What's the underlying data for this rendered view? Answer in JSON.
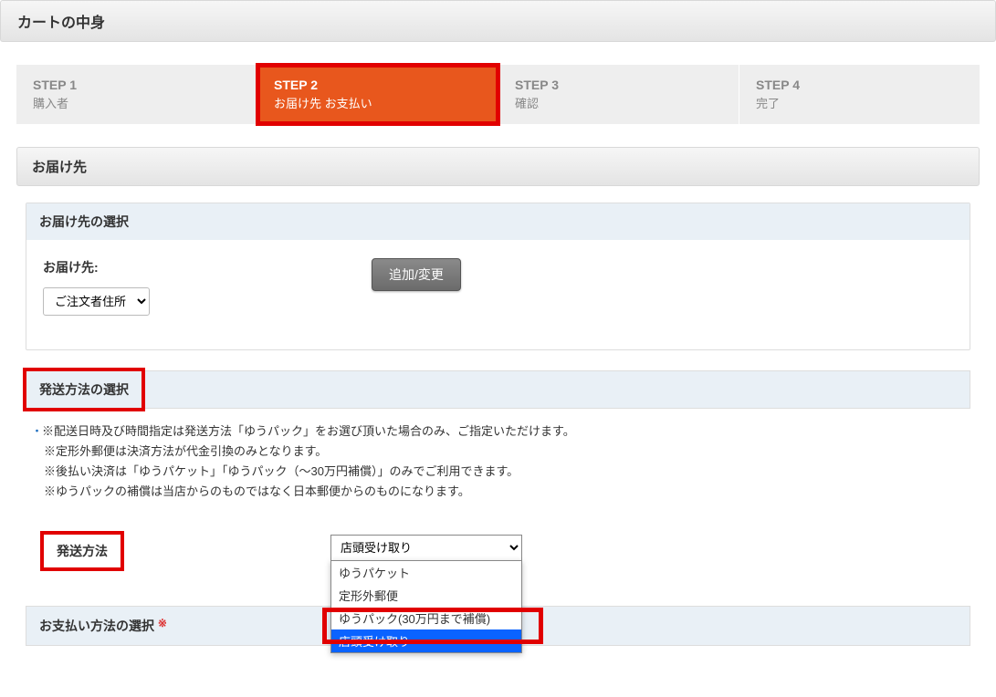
{
  "page_title": "カートの中身",
  "steps": [
    {
      "num": "STEP 1",
      "label": "購入者"
    },
    {
      "num": "STEP 2",
      "label": "お届け先 お支払い"
    },
    {
      "num": "STEP 3",
      "label": "確認"
    },
    {
      "num": "STEP 4",
      "label": "完了"
    }
  ],
  "active_step_index": 1,
  "delivery": {
    "section_title": "お届け先",
    "panel_title": "お届け先の選択",
    "label": "お届け先:",
    "select_value": "ご注文者住所",
    "add_change_button": "追加/変更"
  },
  "shipping": {
    "panel_title": "発送方法の選択",
    "notes": [
      "※配送日時及び時間指定は発送方法「ゆうパック」をお選び頂いた場合のみ、ご指定いただけます。",
      "※定形外郵便は決済方法が代金引換のみとなります。",
      "※後払い決済は「ゆうパケット」「ゆうパック（～30万円補償）」のみでご利用できます。",
      "※ゆうパックの補償は当店からのものではなく日本郵便からのものになります。"
    ],
    "label": "発送方法",
    "selected": "店頭受け取り",
    "options": [
      "ゆうパケット",
      "定形外郵便",
      "ゆうパック(30万円まで補償)",
      "店頭受け取り"
    ]
  },
  "payment": {
    "panel_title": "お支払い方法の選択",
    "required_mark": "※"
  }
}
